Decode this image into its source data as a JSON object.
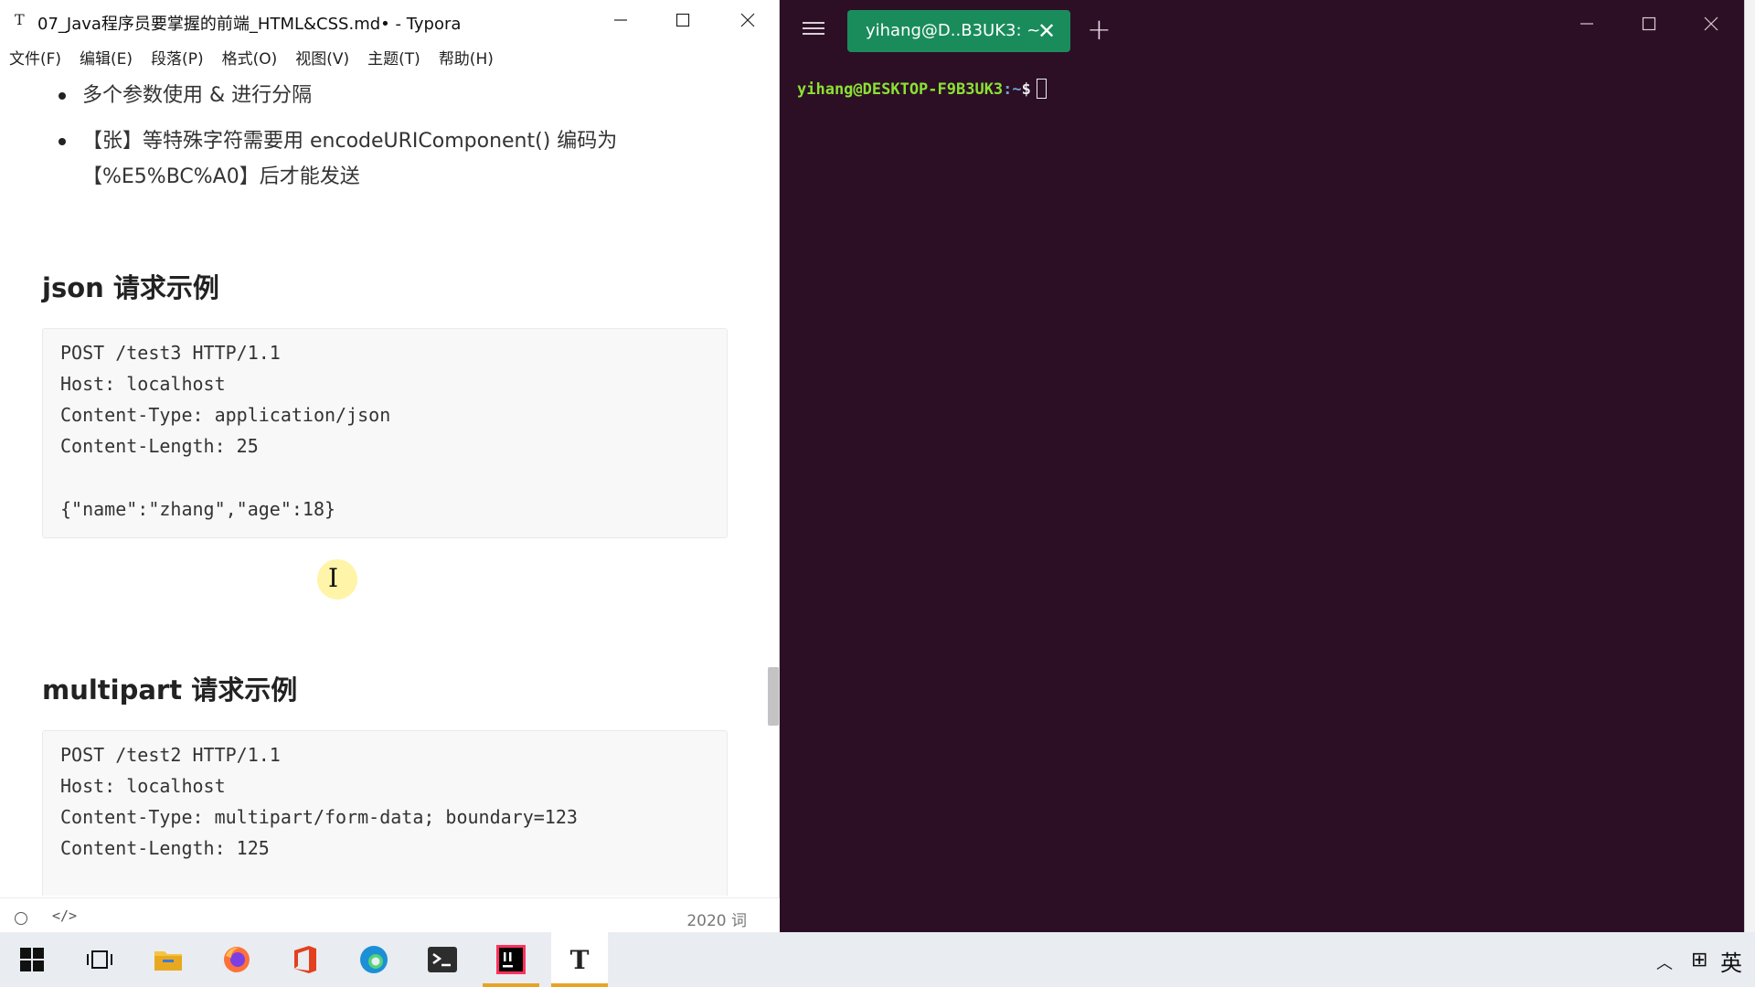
{
  "typora": {
    "app_icon": "T",
    "title": "07_Java程序员要掌握的前端_HTML&CSS.md• - Typora",
    "menu": [
      "文件(F)",
      "编辑(E)",
      "段落(P)",
      "格式(O)",
      "视图(V)",
      "主题(T)",
      "帮助(H)"
    ],
    "bullets": {
      "b1": "多个参数使用 & 进行分隔",
      "b2_line1": "【张】等特殊字符需要用 encodeURIComponent() 编码为",
      "b2_line2": "【%E5%BC%A0】后才能发送"
    },
    "heading_json": "json 请求示例",
    "code_json": [
      "POST /test3 HTTP/1.1",
      "Host: localhost",
      "Content-Type: application/json",
      "Content-Length: 25",
      "",
      "{\"name\":\"zhang\",\"age\":18}"
    ],
    "heading_multipart": "multipart 请求示例",
    "code_multipart": [
      "POST /test2 HTTP/1.1",
      "Host: localhost",
      "Content-Type: multipart/form-data; boundary=123",
      "Content-Length: 125"
    ],
    "status": {
      "source_icon": "</>",
      "word_count": "2020 词"
    }
  },
  "terminal": {
    "tab_label": "yihang@D..B3UK3: ~",
    "prompt_user": "yihang@DESKTOP-F9B3UK3",
    "prompt_path": ":~",
    "prompt_symbol": "$"
  },
  "taskbar": {
    "apps": [
      "start-icon",
      "task-view-icon",
      "file-explorer-icon",
      "firefox-icon",
      "office-icon",
      "edge-icon",
      "terminal-icon",
      "intellij-icon",
      "typora-icon"
    ],
    "ime_language": "英"
  },
  "colors": {
    "terminal_bg": "#2c0f25",
    "terminal_tab": "#1a8c5b",
    "prompt_green": "#8ae234",
    "prompt_blue": "#729fcf",
    "taskbar_active_indicator": "#e7a424"
  }
}
